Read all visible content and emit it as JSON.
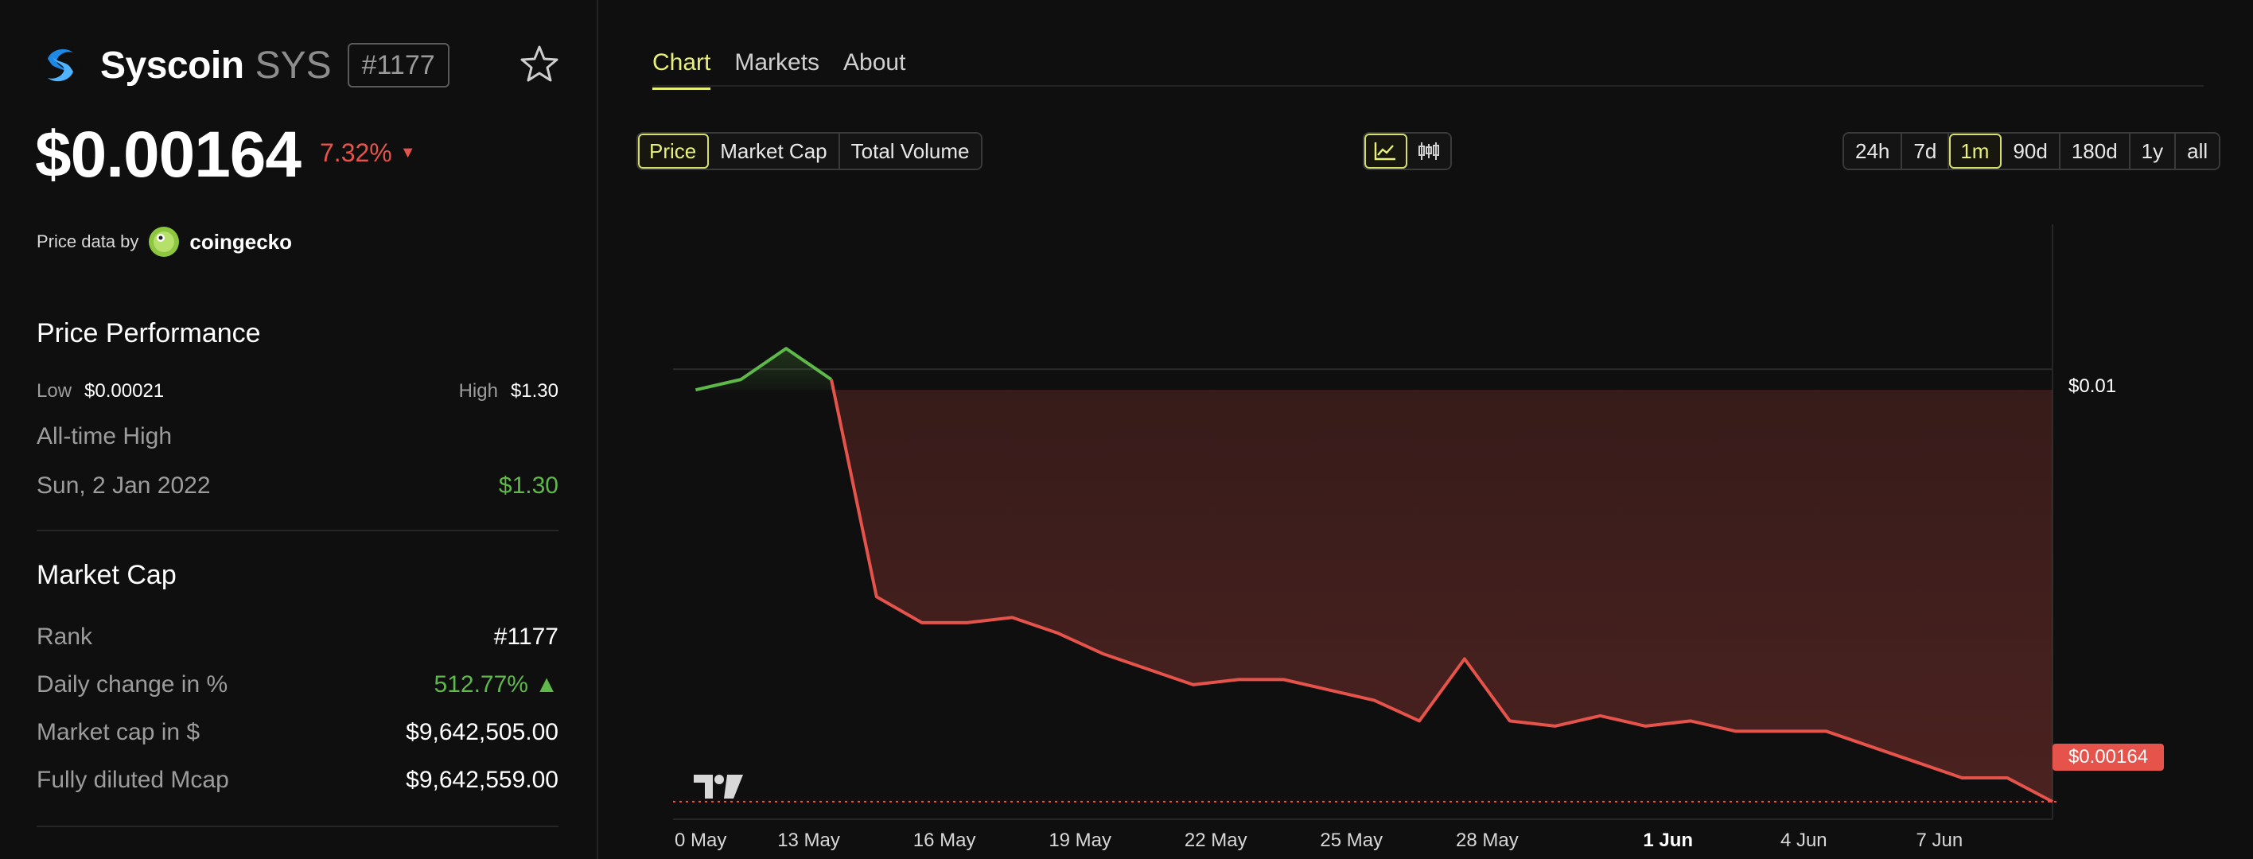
{
  "coin": {
    "name": "Syscoin",
    "symbol": "SYS",
    "rank_badge": "#1177",
    "price": "$0.00164",
    "change": "7.32%",
    "change_arrow": "▼",
    "price_data_label": "Price data by",
    "provider": "coingecko"
  },
  "performance": {
    "title": "Price Performance",
    "low_label": "Low",
    "low_value": "$0.00021",
    "high_label": "High",
    "high_value": "$1.30",
    "ath_label": "All-time High",
    "ath_date": "Sun, 2 Jan 2022",
    "ath_value": "$1.30"
  },
  "market_cap": {
    "title": "Market Cap",
    "rows": [
      {
        "label": "Rank",
        "value": "#1177"
      },
      {
        "label": "Daily change in %",
        "value": "512.77% ▲"
      },
      {
        "label": "Market cap in $",
        "value": "$9,642,505.00"
      },
      {
        "label": "Fully diluted Mcap",
        "value": "$9,642,559.00"
      }
    ]
  },
  "tabs": [
    {
      "label": "Chart",
      "active": true
    },
    {
      "label": "Markets",
      "active": false
    },
    {
      "label": "About",
      "active": false
    }
  ],
  "metric_buttons": [
    {
      "label": "Price",
      "active": true
    },
    {
      "label": "Market Cap",
      "active": false
    },
    {
      "label": "Total Volume",
      "active": false
    }
  ],
  "chart_type_buttons": [
    {
      "icon": "line-chart-icon",
      "active": true
    },
    {
      "icon": "candlestick-icon",
      "active": false
    }
  ],
  "range_buttons": [
    {
      "label": "24h",
      "active": false
    },
    {
      "label": "7d",
      "active": false
    },
    {
      "label": "1m",
      "active": true
    },
    {
      "label": "90d",
      "active": false
    },
    {
      "label": "180d",
      "active": false
    },
    {
      "label": "1y",
      "active": false
    },
    {
      "label": "all",
      "active": false
    }
  ],
  "colors": {
    "accent": "#e8f07a",
    "down": "#e5534b",
    "up": "#5fb84a",
    "background": "#0f0f0f"
  },
  "chart_data": {
    "type": "area",
    "x_ticks": [
      {
        "label": "0 May",
        "bold": false
      },
      {
        "label": "13 May",
        "bold": false
      },
      {
        "label": "16 May",
        "bold": false
      },
      {
        "label": "19 May",
        "bold": false
      },
      {
        "label": "22 May",
        "bold": false
      },
      {
        "label": "25 May",
        "bold": false
      },
      {
        "label": "28 May",
        "bold": false
      },
      {
        "label": "1 Jun",
        "bold": true
      },
      {
        "label": "4 Jun",
        "bold": false
      },
      {
        "label": "7 Jun",
        "bold": false
      }
    ],
    "y_labels": [
      "$0.01"
    ],
    "last_price_label": "$0.00164",
    "ylim": [
      0.0013,
      0.0128
    ],
    "y_grid_value": 0.01,
    "x_day_range": [
      10,
      40.5
    ],
    "points": [
      [
        10.5,
        0.0096
      ],
      [
        11.5,
        0.0098
      ],
      [
        12.5,
        0.0104
      ],
      [
        13.5,
        0.0098
      ],
      [
        14.5,
        0.0056
      ],
      [
        15.5,
        0.0051
      ],
      [
        16.5,
        0.0051
      ],
      [
        17.5,
        0.0052
      ],
      [
        18.5,
        0.0049
      ],
      [
        19.5,
        0.0045
      ],
      [
        20.5,
        0.0042
      ],
      [
        21.5,
        0.0039
      ],
      [
        22.5,
        0.004
      ],
      [
        23.5,
        0.004
      ],
      [
        24.5,
        0.0038
      ],
      [
        25.5,
        0.0036
      ],
      [
        26.5,
        0.0032
      ],
      [
        27.5,
        0.0044
      ],
      [
        28.5,
        0.0032
      ],
      [
        29.5,
        0.0031
      ],
      [
        30.5,
        0.0033
      ],
      [
        31.5,
        0.0031
      ],
      [
        32.5,
        0.0032
      ],
      [
        33.5,
        0.003
      ],
      [
        34.5,
        0.003
      ],
      [
        35.5,
        0.003
      ],
      [
        36.5,
        0.0027
      ],
      [
        37.5,
        0.0024
      ],
      [
        38.5,
        0.0021
      ],
      [
        39.5,
        0.0021
      ],
      [
        40.5,
        0.00164
      ]
    ],
    "peak_split_index": 3,
    "last_price": 0.00164
  }
}
